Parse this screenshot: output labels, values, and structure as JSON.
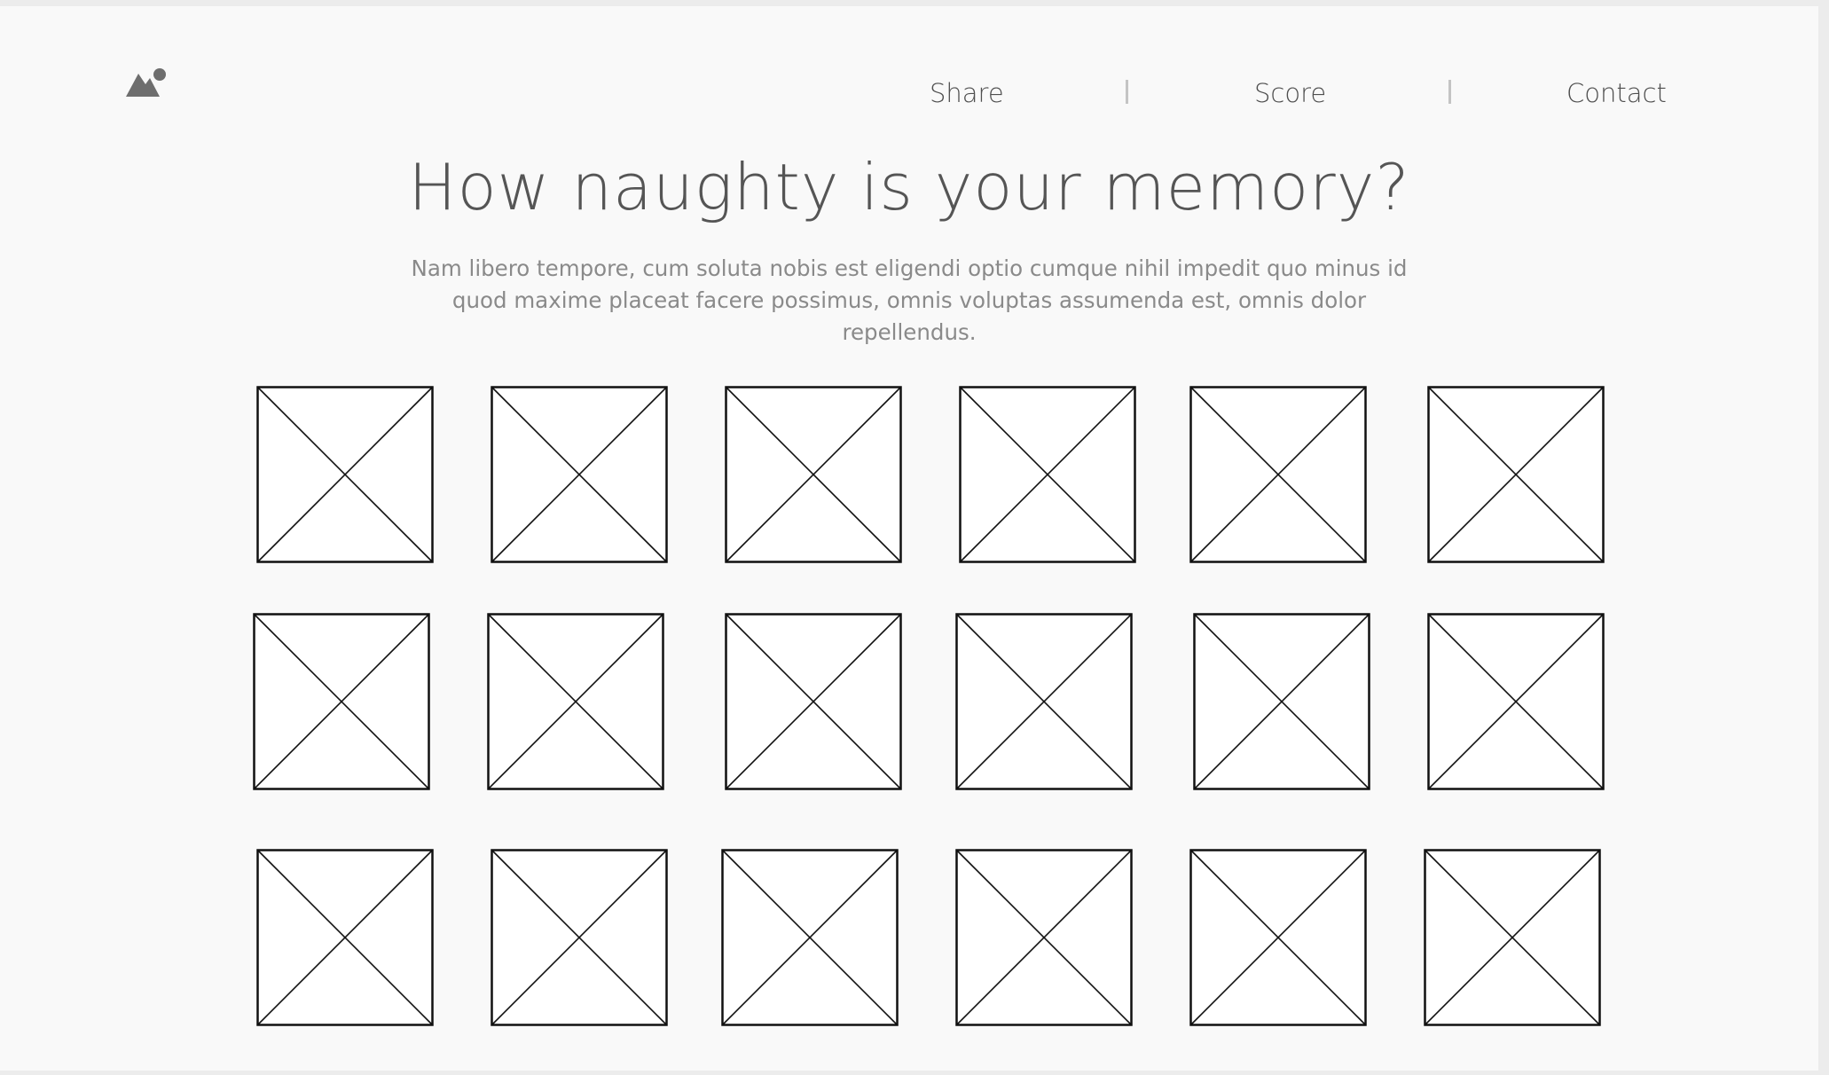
{
  "nav": {
    "items": [
      {
        "label": "Share"
      },
      {
        "label": "Score"
      },
      {
        "label": "Contact"
      }
    ]
  },
  "logo": {
    "icon": "image-placeholder-icon"
  },
  "hero": {
    "title": "How naughty is your memory?",
    "description": "Nam libero tempore, cum soluta nobis est eligendi optio cumque nihil impedit quo minus id quod maxime placeat facere possimus, omnis voluptas assumenda est, omnis dolor repellendus."
  },
  "board": {
    "rows": 3,
    "columns": 6,
    "card_icon": "image-placeholder-icon"
  }
}
